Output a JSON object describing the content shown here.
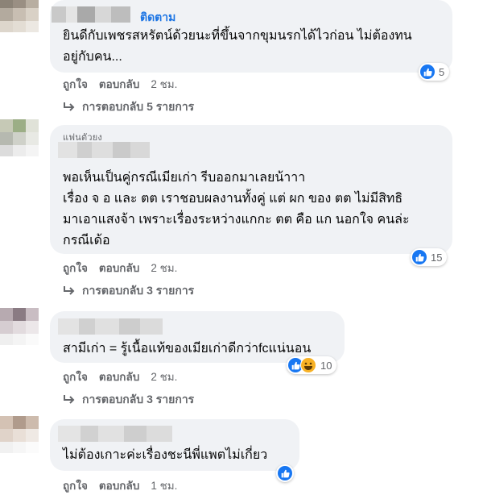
{
  "comments": [
    {
      "follow_label": "ติดตาม",
      "tag": "",
      "text": "ยินดีกับเพชรสหรัตน์ด้วยนะที่ขึ้นจากขุมนรกได้ไวก่อน ไม่ต้องทน\nอยู่กับคน...",
      "like_label": "ถูกใจ",
      "reply_label": "ตอบกลับ",
      "time": "2 ชม.",
      "replies_label": "การตอบกลับ 5 รายการ",
      "reaction_count": "5",
      "reactions": [
        "like"
      ]
    },
    {
      "follow_label": "",
      "tag": "แฟนตัวยง",
      "text": "พอเห็นเป็นคู่กรณีเมียเก่า รีบออกมาเลยน้าาา\nเรื่อง จ อ และ ตต เราชอบผลงานทั้งคู่ แต่ ผก ของ ตต ไม่มีสิทธิ\nมาเอาแสงจ้า เพราะเรื่องระหว่างแกกะ ตต คือ แก นอกใจ คนล่ะ\nกรณีเด้อ",
      "like_label": "ถูกใจ",
      "reply_label": "ตอบกลับ",
      "time": "2 ชม.",
      "replies_label": "การตอบกลับ 3 รายการ",
      "reaction_count": "15",
      "reactions": [
        "like"
      ]
    },
    {
      "follow_label": "",
      "tag": "",
      "text": "สามีเก่า = รู้เนื้อแท้ของเมียเก่าดีกว่าfcแน่นอน",
      "like_label": "ถูกใจ",
      "reply_label": "ตอบกลับ",
      "time": "2 ชม.",
      "replies_label": "การตอบกลับ 3 รายการ",
      "reaction_count": "10",
      "reactions": [
        "like",
        "haha"
      ]
    },
    {
      "follow_label": "",
      "tag": "",
      "text": "ไม่ต้องเกาะค่ะเรื่องชะนีพี่แพตไม่เกี่ยว",
      "like_label": "ถูกใจ",
      "reply_label": "ตอบกลับ",
      "time": "1 ชม.",
      "replies_label": "",
      "reaction_count": "",
      "reactions": [
        "like"
      ]
    }
  ],
  "colors": {
    "link": "#1b74e4",
    "bubble": "#f0f2f5",
    "meta": "#65676b",
    "like": "#1877f2",
    "haha": "#f7b125"
  },
  "icons": {
    "reply_arrow": "reply-arrow-icon",
    "like": "like-icon",
    "haha": "haha-icon"
  }
}
